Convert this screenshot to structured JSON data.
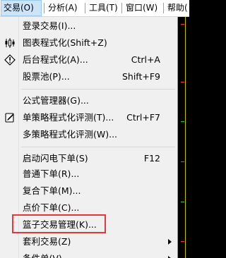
{
  "menubar": {
    "items": [
      {
        "label": "交易(O)"
      },
      {
        "label": "分析(A)"
      },
      {
        "label": "工具(T)"
      },
      {
        "label": "窗口(W)"
      },
      {
        "label": "帮助("
      }
    ]
  },
  "menu": {
    "items": [
      {
        "label": "登录交易(I)...",
        "shortcut": ""
      },
      {
        "label": "图表程式化(Shift+Z)",
        "shortcut": ""
      },
      {
        "label": "后台程式化(A)...",
        "shortcut": "Ctrl+A"
      },
      {
        "label": "股票池(P)...",
        "shortcut": "Shift+F9"
      },
      {
        "label": "公式管理器(G)...",
        "shortcut": ""
      },
      {
        "label": "单策略程式化评测(T)...",
        "shortcut": "Ctrl+F7"
      },
      {
        "label": "多策略程式化评测(W)...",
        "shortcut": ""
      },
      {
        "label": "启动闪电下单(S)",
        "shortcut": "F12"
      },
      {
        "label": "普通下单(R)...",
        "shortcut": ""
      },
      {
        "label": "复合下单(M)...",
        "shortcut": ""
      },
      {
        "label": "点价下单(C)...",
        "shortcut": ""
      },
      {
        "label": "篮子交易管理(K)...",
        "shortcut": ""
      },
      {
        "label": "套利交易(Z)",
        "shortcut": ""
      },
      {
        "label": "条件单(V)",
        "shortcut": ""
      }
    ]
  },
  "icons": {
    "chart_program": "chart-program-icon",
    "backend_program": "backend-program-icon",
    "strategy_eval": "strategy-eval-icon",
    "submenu_arrow": "submenu-arrow-icon"
  },
  "colors": {
    "highlight": "#e0393e",
    "active_menu_bg": "#cce4f7"
  }
}
